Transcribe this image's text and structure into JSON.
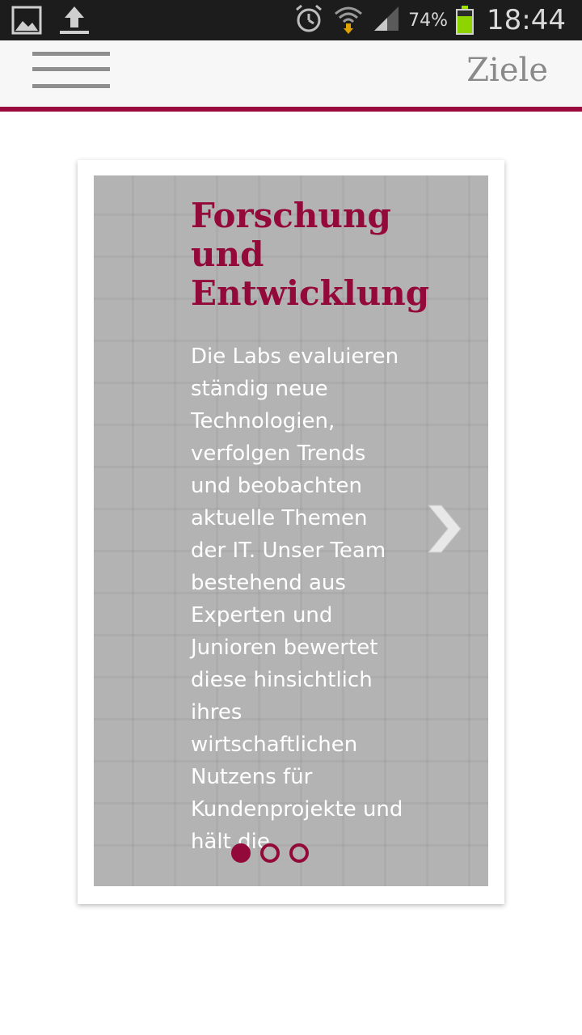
{
  "statusbar": {
    "battery_percent": "74%",
    "battery_level": 0.74,
    "time": "18:44",
    "icons": [
      "gallery-icon",
      "upload-icon",
      "alarm-icon",
      "wifi-icon",
      "signal-icon",
      "battery-icon"
    ]
  },
  "appbar": {
    "title": "Ziele",
    "menu_icon": "hamburger-menu-icon",
    "accent_color": "#9b0a3c"
  },
  "slide": {
    "title": "Forschung\n      und\nEntwicklung",
    "text": "Die Labs evaluieren ständig neue Technologien, verfolgen Trends und beobachten aktuelle Themen der IT. Unser Team bestehend aus Experten und Junioren bewertet diese hinsichtlich ihres wirtschaftlichen Nutzens für Kundenprojekte und hält die",
    "next_icon": "chevron-right-icon",
    "title_color": "#93093a"
  },
  "pagination": {
    "count": 3,
    "active_index": 0
  }
}
